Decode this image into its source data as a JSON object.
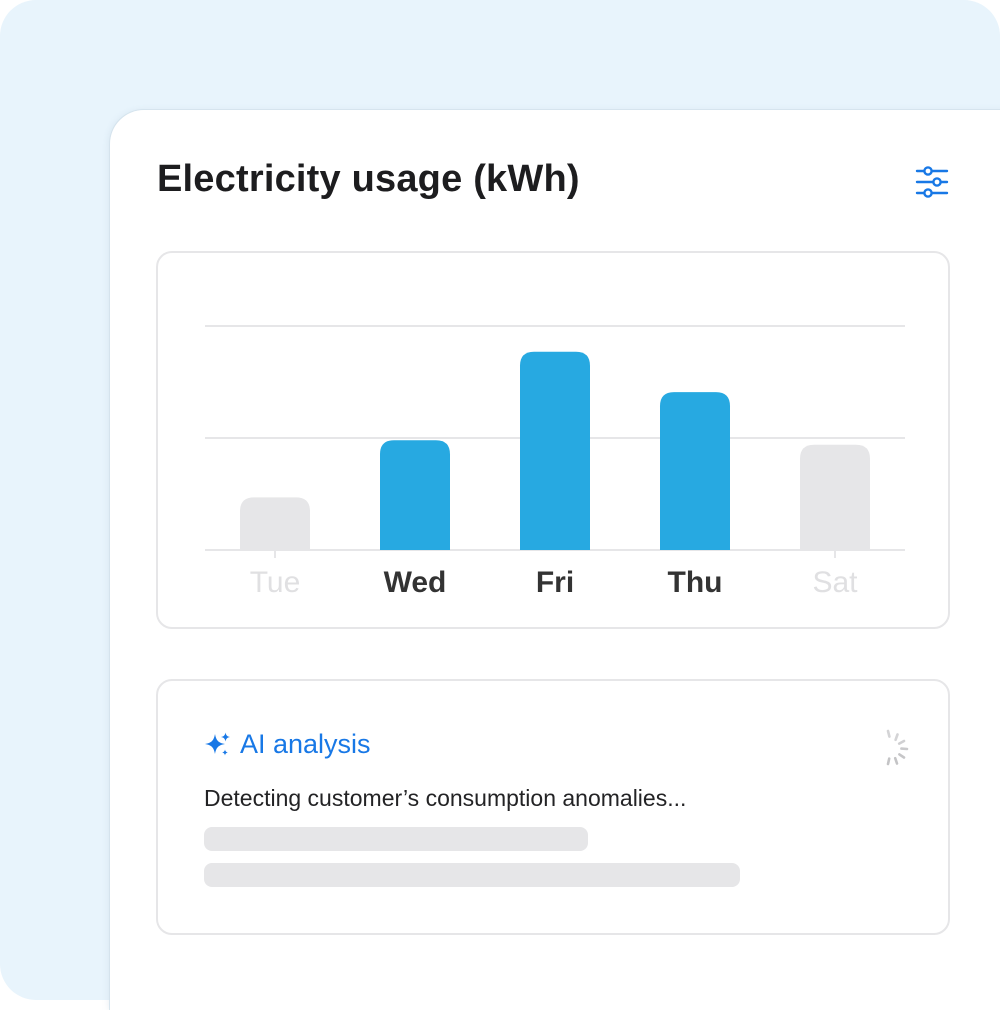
{
  "card": {
    "title": "Electricity usage (kWh)"
  },
  "icons": {
    "settings": "sliders-icon",
    "ai": "sparkle-icon",
    "loading": "spinner-icon"
  },
  "colors": {
    "accent": "#1878e6",
    "bar_active": "#27a9e1",
    "bar_inactive": "#e6e6e8",
    "label_active": "#333333",
    "label_inactive": "#e0e0e2"
  },
  "chart_data": {
    "type": "bar",
    "categories": [
      "Tue",
      "Wed",
      "Fri",
      "Thu",
      "Sat"
    ],
    "values": [
      0.47,
      0.98,
      1.77,
      1.41,
      0.94
    ],
    "highlighted": [
      false,
      true,
      true,
      true,
      false
    ],
    "ylim": [
      0,
      2
    ],
    "grid": true,
    "title": "",
    "xlabel": "",
    "ylabel": ""
  },
  "ai_analysis": {
    "title": "AI analysis",
    "status": "Detecting customer’s consumption anomalies..."
  }
}
